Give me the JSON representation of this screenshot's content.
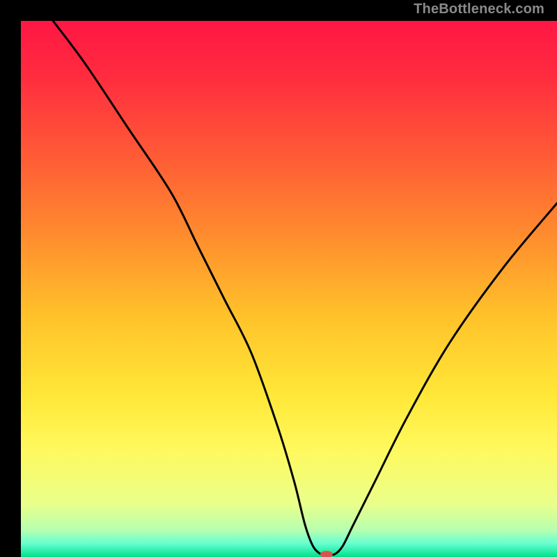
{
  "watermark": "TheBottleneck.com",
  "chart_data": {
    "type": "line",
    "title": "",
    "xlabel": "",
    "ylabel": "",
    "xlim": [
      0,
      100
    ],
    "ylim": [
      0,
      100
    ],
    "grid": false,
    "legend": false,
    "gradient_stops": [
      {
        "offset": 0.0,
        "color": "#ff1744"
      },
      {
        "offset": 0.1,
        "color": "#ff2b3f"
      },
      {
        "offset": 0.25,
        "color": "#ff5a36"
      },
      {
        "offset": 0.4,
        "color": "#ff8c2e"
      },
      {
        "offset": 0.55,
        "color": "#ffc22a"
      },
      {
        "offset": 0.7,
        "color": "#ffe838"
      },
      {
        "offset": 0.8,
        "color": "#fff95e"
      },
      {
        "offset": 0.9,
        "color": "#eaff8a"
      },
      {
        "offset": 0.95,
        "color": "#b6ffb0"
      },
      {
        "offset": 0.975,
        "color": "#66ffd0"
      },
      {
        "offset": 1.0,
        "color": "#00e08a"
      }
    ],
    "series": [
      {
        "name": "bottleneck-curve",
        "x": [
          6,
          12,
          20,
          28,
          33,
          38,
          43,
          48,
          51,
          53,
          54.5,
          56,
          57,
          58.5,
          60,
          62,
          66,
          72,
          80,
          90,
          100
        ],
        "y": [
          100,
          92,
          80,
          68,
          58,
          48,
          38,
          24,
          14,
          6,
          2,
          0.5,
          0.5,
          0.5,
          2,
          6,
          14,
          26,
          40,
          54,
          66
        ]
      }
    ],
    "marker": {
      "x": 57,
      "y": 0.5,
      "color": "#d9534f",
      "rx": 9,
      "ry": 5
    }
  }
}
